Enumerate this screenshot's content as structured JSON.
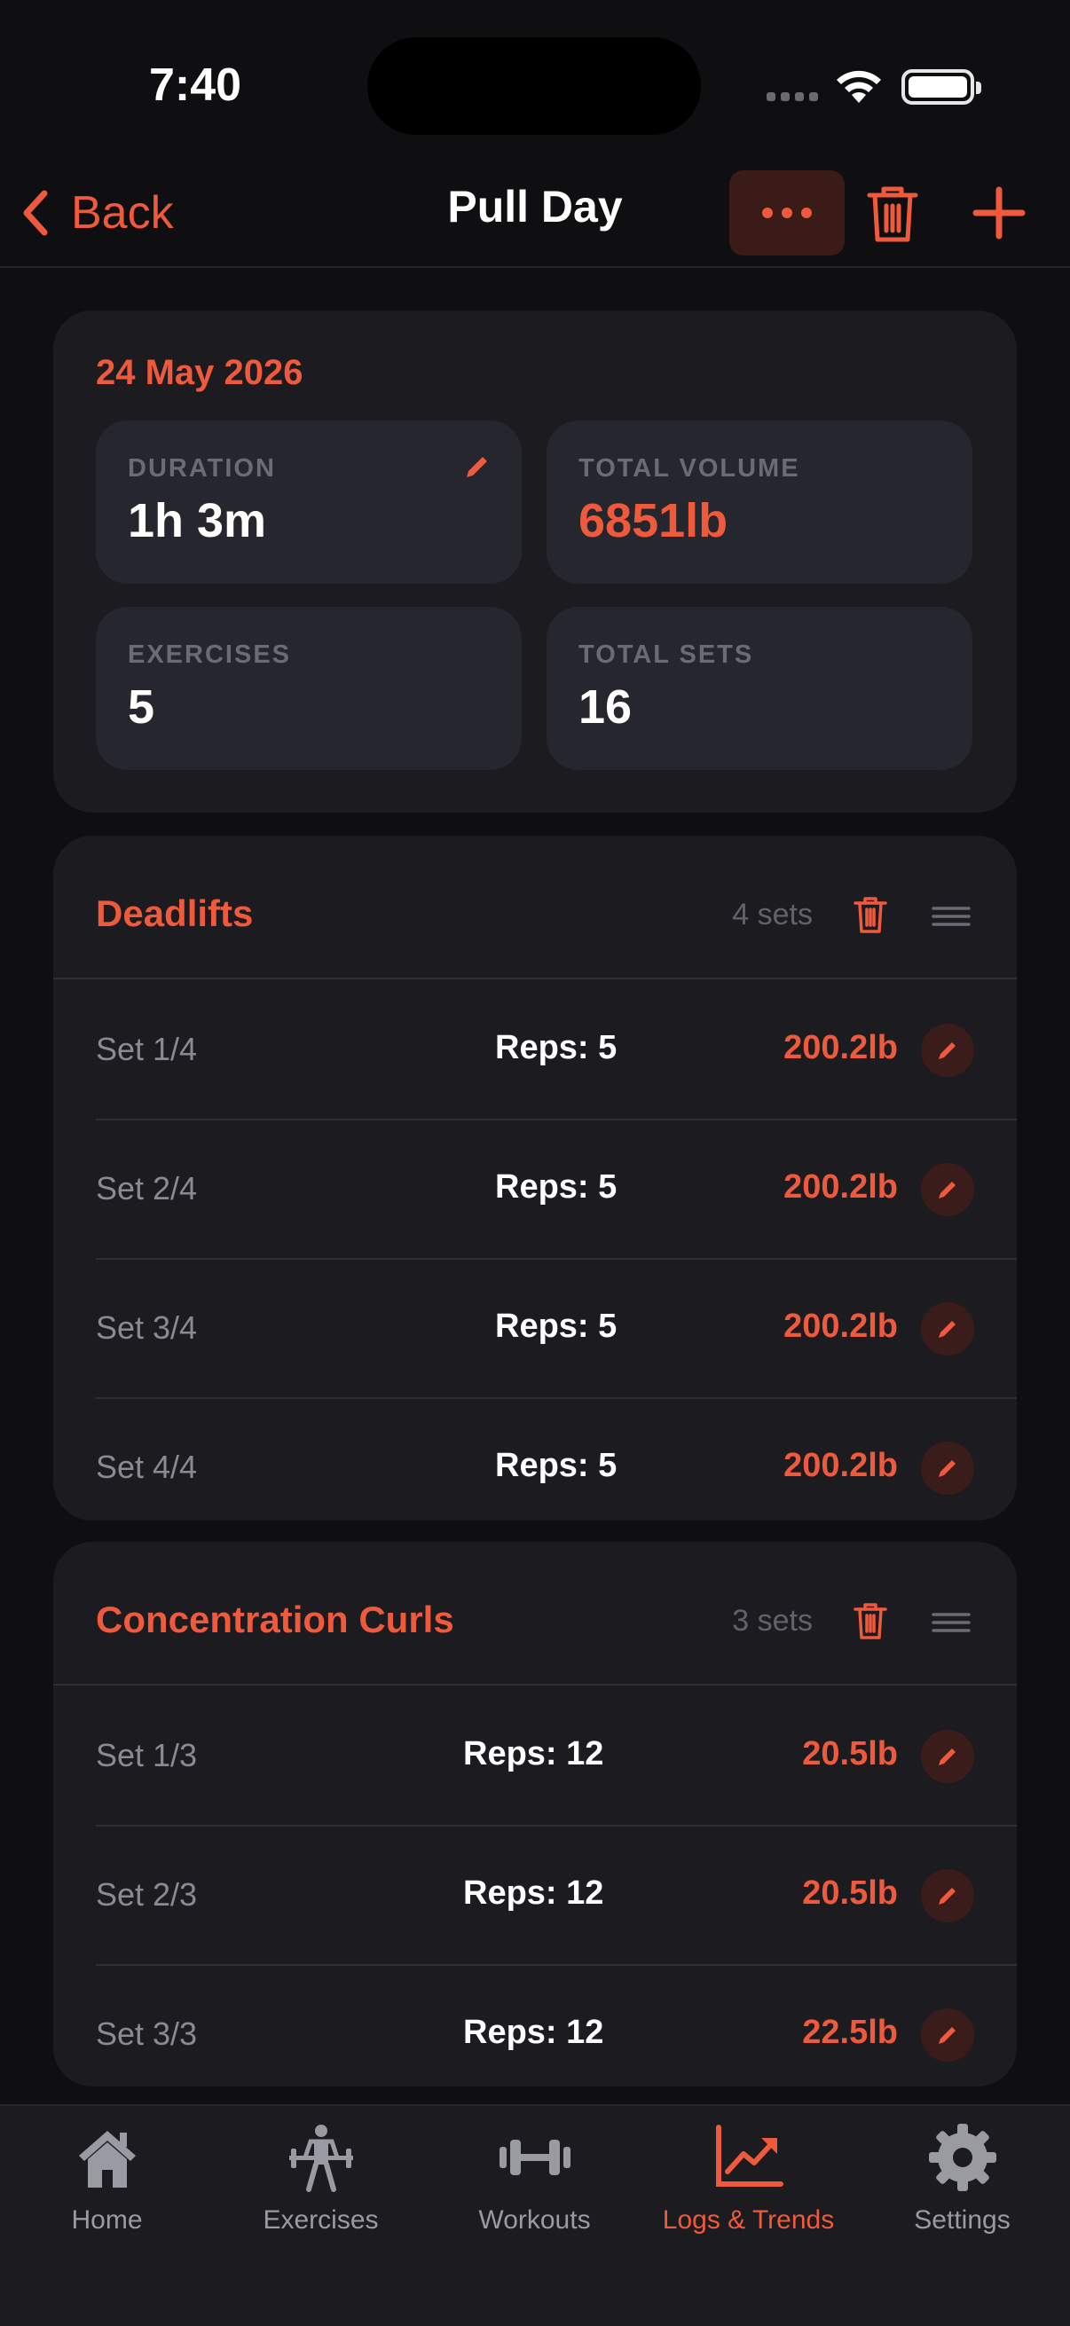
{
  "status_bar": {
    "time": "7:40"
  },
  "nav": {
    "back_label": "Back",
    "title": "Pull Day"
  },
  "summary": {
    "date": "24 May 2026",
    "stats": [
      {
        "label": "DURATION",
        "value": "1h 3m"
      },
      {
        "label": "TOTAL VOLUME",
        "value": "6851lb"
      },
      {
        "label": "EXERCISES",
        "value": "5"
      },
      {
        "label": "TOTAL SETS",
        "value": "16"
      }
    ]
  },
  "exercises": [
    {
      "name": "Deadlifts",
      "sets_label": "4 sets",
      "sets": [
        {
          "label": "Set 1/4",
          "reps": "Reps: 5",
          "weight": "200.2lb"
        },
        {
          "label": "Set 2/4",
          "reps": "Reps: 5",
          "weight": "200.2lb"
        },
        {
          "label": "Set 3/4",
          "reps": "Reps: 5",
          "weight": "200.2lb"
        },
        {
          "label": "Set 4/4",
          "reps": "Reps: 5",
          "weight": "200.2lb"
        }
      ]
    },
    {
      "name": "Concentration Curls",
      "sets_label": "3 sets",
      "sets": [
        {
          "label": "Set 1/3",
          "reps": "Reps: 12",
          "weight": "20.5lb"
        },
        {
          "label": "Set 2/3",
          "reps": "Reps: 12",
          "weight": "20.5lb"
        },
        {
          "label": "Set 3/3",
          "reps": "Reps: 12",
          "weight": "22.5lb"
        }
      ]
    }
  ],
  "tabs": [
    {
      "label": "Home",
      "icon": "house-icon"
    },
    {
      "label": "Exercises",
      "icon": "weightlifter-icon"
    },
    {
      "label": "Workouts",
      "icon": "dumbbell-icon"
    },
    {
      "label": "Logs & Trends",
      "icon": "trend-chart-icon",
      "active": true
    },
    {
      "label": "Settings",
      "icon": "gear-icon"
    }
  ],
  "colors": {
    "accent": "#f05a3c",
    "background": "#0f0f12",
    "card": "#1b1b20",
    "tile": "#26262e"
  }
}
